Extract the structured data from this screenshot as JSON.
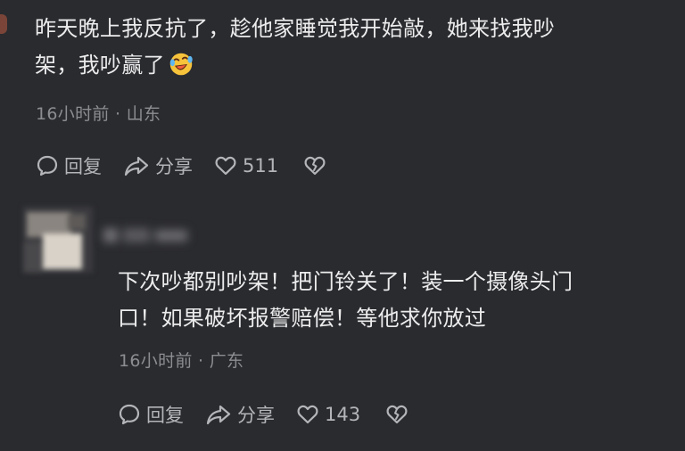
{
  "comments": [
    {
      "text_line1": "昨天晚上我反抗了，趁他家睡觉我开始敲，她来找我吵",
      "text_line2": "架，我吵赢了",
      "emoji": "laughing-crying-emoji",
      "time": "16小时前",
      "location": "山东",
      "reply_label": "回复",
      "share_label": "分享",
      "likes": "511"
    },
    {
      "author_blurred": true,
      "text_line1": "下次吵都别吵架！把门铃关了！装一个摄像头门",
      "text_line2": "口！如果破坏报警赔偿！等他求你放过",
      "time": "16小时前",
      "location": "广东",
      "reply_label": "回复",
      "share_label": "分享",
      "likes": "143"
    }
  ],
  "meta_separator": "·",
  "icons": {
    "reply": "comment-bubble-icon",
    "share": "share-arrow-icon",
    "like": "heart-outline-icon",
    "dislike": "broken-heart-icon"
  },
  "colors": {
    "background": "#2a2b2f",
    "text": "#ececed",
    "meta": "#8c8d91",
    "action": "#b4b5b9"
  }
}
